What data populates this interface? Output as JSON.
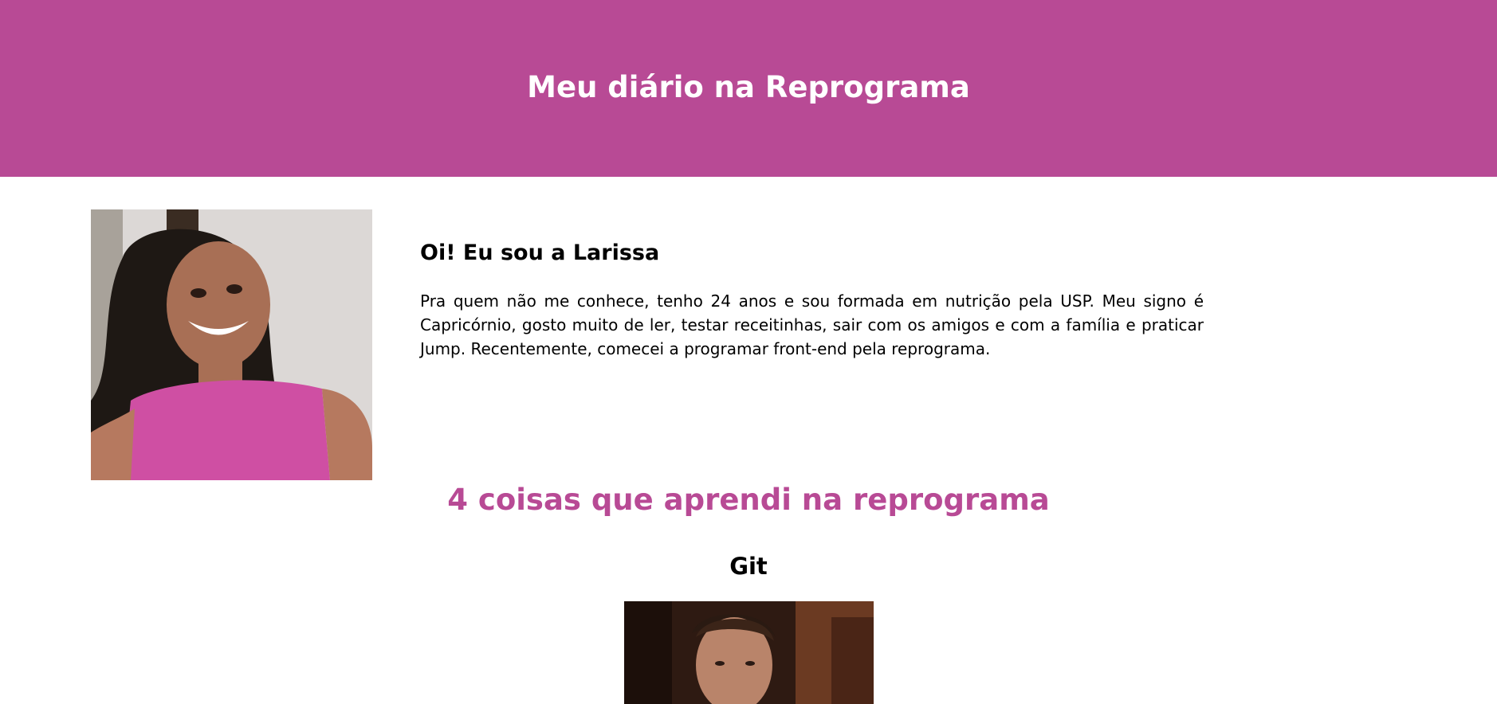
{
  "header": {
    "title": "Meu diário na Reprograma",
    "background_color": "#b84a95"
  },
  "about": {
    "photo_alt": "profile-photo",
    "title": "Oi! Eu sou a Larissa",
    "text": "Pra quem não me conhece, tenho 24 anos e sou formada em nutrição pela USP. Meu signo é Capricórnio, gosto muito de ler, testar receitinhas, sair com os amigos e com a família e praticar Jump. Recentemente, comecei a programar front-end pela reprograma."
  },
  "learnings": {
    "title": "4 coisas que aprendi na reprograma",
    "title_color": "#b84a95",
    "items": [
      {
        "title": "Git",
        "image": "gif-image"
      }
    ]
  }
}
